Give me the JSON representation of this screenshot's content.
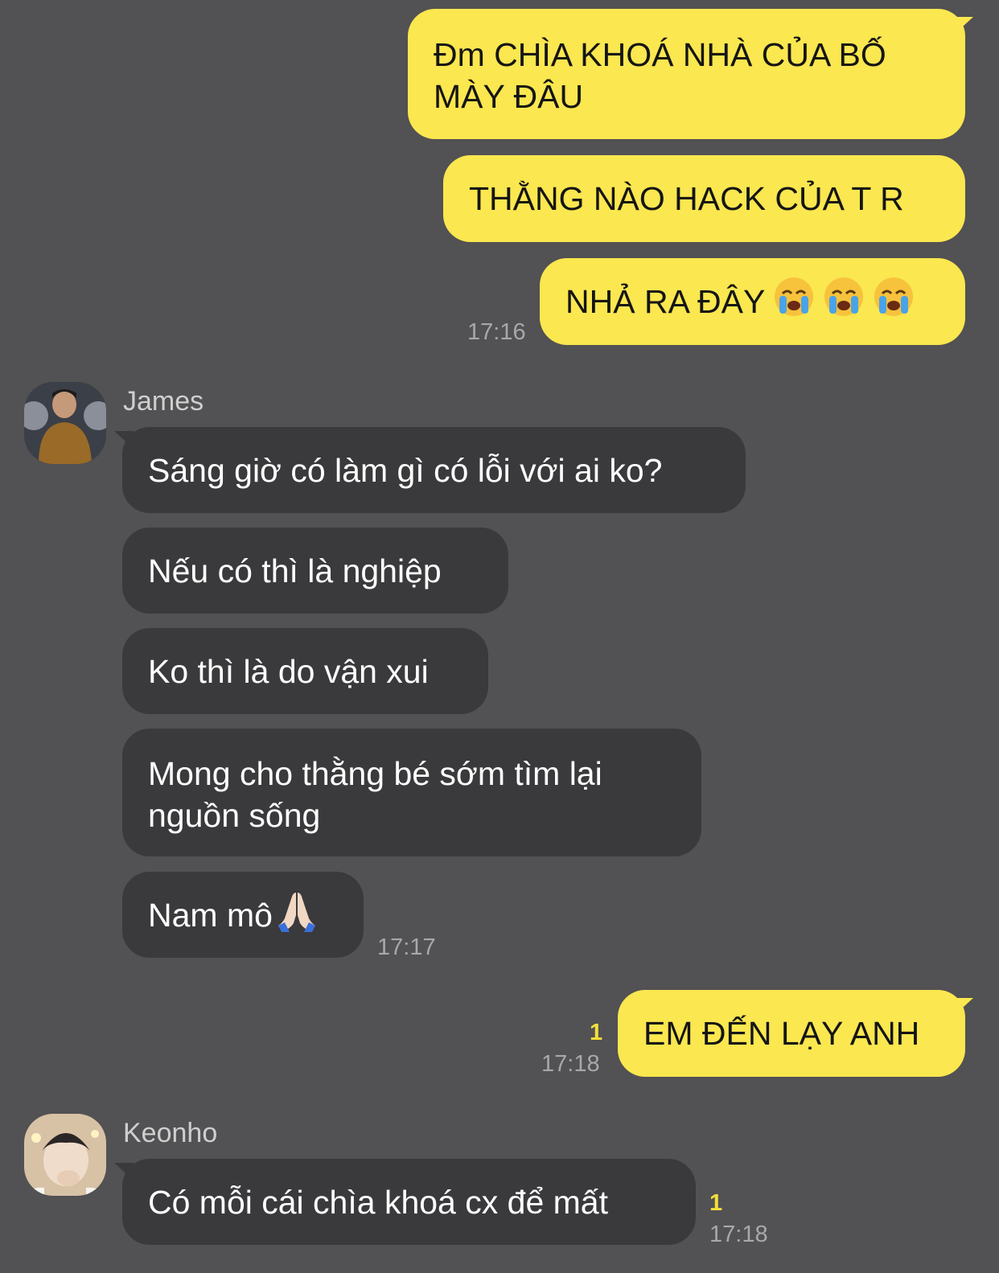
{
  "colors": {
    "background": "#525153",
    "my_bubble": "#fbe74f",
    "their_bubble": "#3a393b",
    "timestamp": "#a9a8a9",
    "unread": "#f4df3a"
  },
  "messages": {
    "m1": "Đm CHÌA KHOÁ NHÀ CỦA BỐ MÀY ĐÂU",
    "m2": "THẰNG NÀO HACK CỦA T R",
    "m3": "NHẢ RA ĐÂY",
    "m3_time": "17:16",
    "james_name": "James",
    "j1": "Sáng giờ có làm gì có lỗi với ai ko?",
    "j2": "Nếu có thì là nghiệp",
    "j3": "Ko thì là do vận xui",
    "j4": "Mong cho thằng bé sớm tìm lại nguồn sống",
    "j5": "Nam mô",
    "j5_time": "17:17",
    "m4": "EM ĐẾN LẠY ANH",
    "m4_unread": "1",
    "m4_time": "17:18",
    "keonho_name": "Keonho",
    "k1": "Có mỗi cái chìa khoá cx để mất",
    "k1_unread": "1",
    "k1_time": "17:18"
  },
  "icons": {
    "crying": "loudly-crying-face-icon",
    "praying": "folded-hands-icon"
  }
}
